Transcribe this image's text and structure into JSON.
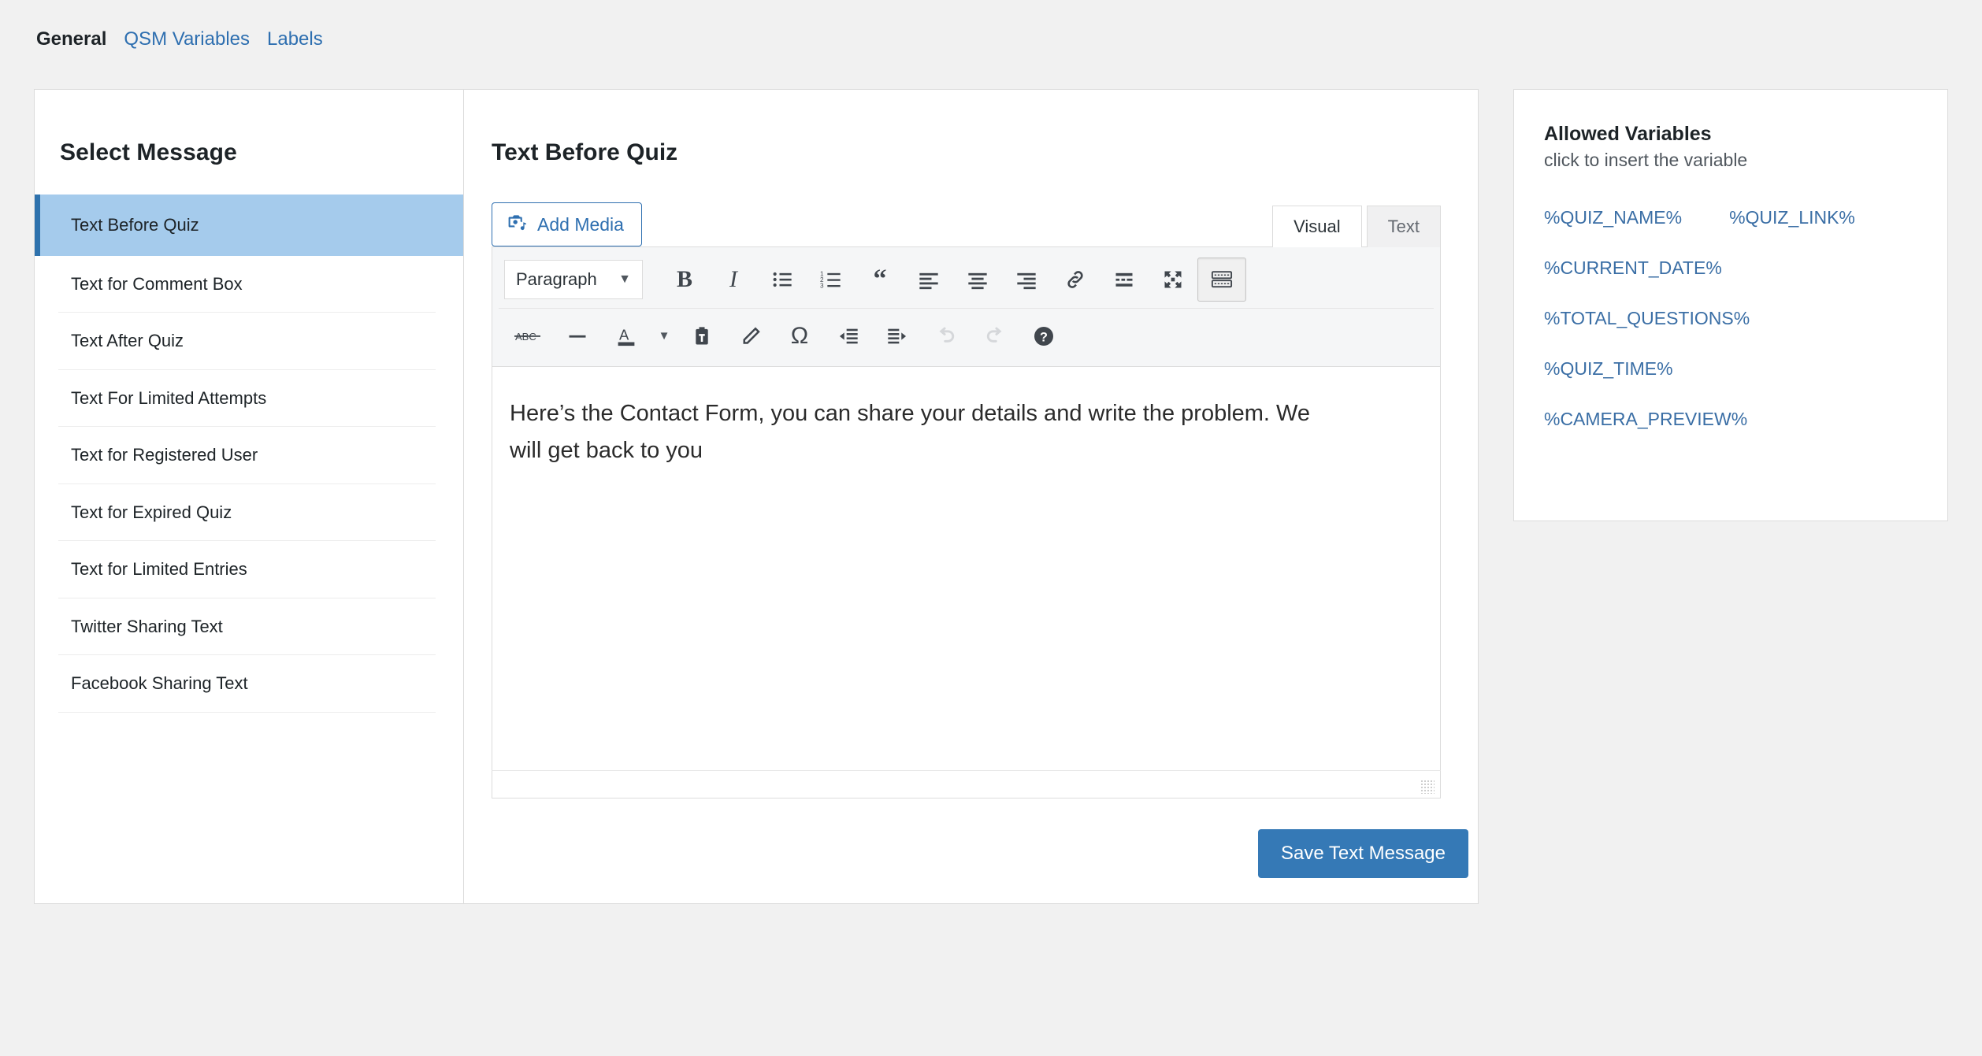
{
  "nav": {
    "tabs": [
      {
        "label": "General",
        "active": true
      },
      {
        "label": "QSM Variables",
        "active": false
      },
      {
        "label": "Labels",
        "active": false
      }
    ]
  },
  "sidebar": {
    "title": "Select Message",
    "items": [
      {
        "label": "Text Before Quiz",
        "selected": true
      },
      {
        "label": "Text for Comment Box",
        "selected": false
      },
      {
        "label": "Text After Quiz",
        "selected": false
      },
      {
        "label": "Text For Limited Attempts",
        "selected": false
      },
      {
        "label": "Text for Registered User",
        "selected": false
      },
      {
        "label": "Text for Expired Quiz",
        "selected": false
      },
      {
        "label": "Text for Limited Entries",
        "selected": false
      },
      {
        "label": "Twitter Sharing Text",
        "selected": false
      },
      {
        "label": "Facebook Sharing Text",
        "selected": false
      }
    ]
  },
  "editor": {
    "title": "Text Before Quiz",
    "add_media_label": "Add Media",
    "tabs": {
      "visual": "Visual",
      "text": "Text"
    },
    "format_select": {
      "value": "Paragraph"
    },
    "content": "Here’s the Contact Form, you can share your details and write the problem. We will get back to you",
    "save_label": "Save Text Message",
    "toolbar_row1": [
      "bold-icon",
      "italic-icon",
      "bulleted-list-icon",
      "numbered-list-icon",
      "blockquote-icon",
      "align-left-icon",
      "align-center-icon",
      "align-right-icon",
      "insert-link-icon",
      "read-more-icon",
      "fullscreen-icon",
      "toolbar-toggle-icon"
    ],
    "toolbar_row2": [
      "strikethrough-icon",
      "horizontal-rule-icon",
      "text-color-icon",
      "text-color-dropdown-icon",
      "paste-as-text-icon",
      "clear-formatting-icon",
      "special-character-icon",
      "outdent-icon",
      "indent-icon",
      "undo-icon",
      "redo-icon",
      "keyboard-shortcuts-help-icon"
    ]
  },
  "variables": {
    "title": "Allowed Variables",
    "subtitle": "click to insert the variable",
    "items": [
      "%QUIZ_NAME%",
      "%QUIZ_LINK%",
      "%CURRENT_DATE%",
      "%TOTAL_QUESTIONS%",
      "%QUIZ_TIME%",
      "%CAMERA_PREVIEW%"
    ]
  },
  "colors": {
    "accent": "#2e6fb0",
    "save_button": "#3579b6",
    "selected_row": "#a5cbec",
    "selected_marker": "#2e72ad",
    "link": "#3a6ea5",
    "page_bg": "#f1f1f1"
  }
}
